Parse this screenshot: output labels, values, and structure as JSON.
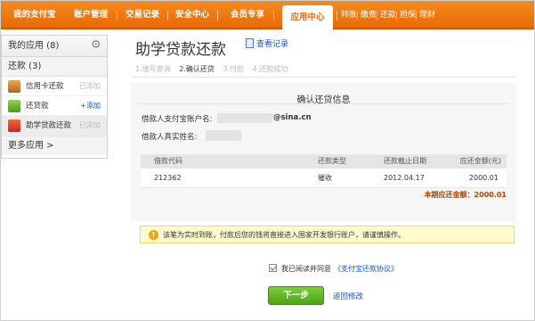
{
  "nav": {
    "items": [
      "我的支付宝",
      "账户管理",
      "交易记录",
      "安全中心",
      "会员专享"
    ],
    "active": "应用中心",
    "sub_links": [
      "转账",
      "缴费",
      "还款",
      "担保",
      "理财"
    ],
    "accent": "#f07a14"
  },
  "sidebar": {
    "title": "我的应用 (8)",
    "group": "还款 (3)",
    "items": [
      {
        "label": "信用卡还款",
        "action": "已添加"
      },
      {
        "label": "还贷款",
        "action": "+添加"
      },
      {
        "label": "助学贷款还款",
        "action": "已添加"
      }
    ],
    "more": "更多应用 >"
  },
  "page": {
    "title": "助学贷款还款",
    "record_link": "查看记录",
    "steps": [
      "1.填写查询",
      "2.确认还贷",
      "3.付款",
      "4.还款成功"
    ]
  },
  "confirm": {
    "heading": "确认还贷信息",
    "account_label": "借款人支付宝账户名:",
    "account_domain": "@sina.cn",
    "name_label": "借款人真实姓名:"
  },
  "table": {
    "headers": [
      "借款代码",
      "还款类型",
      "还款截止日期",
      "应还金额(元)"
    ],
    "rows": [
      [
        "212362",
        "催收",
        "2012.04.17",
        "2000.01"
      ]
    ],
    "total": "本期应还金额：2000.01"
  },
  "notice": {
    "text": "该笔为实时到账，付款后您的钱将直接进入国家开发银行账户，请谨慎操作。"
  },
  "agreement": {
    "prefix": "我已阅读并同意",
    "link": "《支付宝还款协议》"
  },
  "actions": {
    "next": "下一步",
    "back": "返回修改"
  }
}
